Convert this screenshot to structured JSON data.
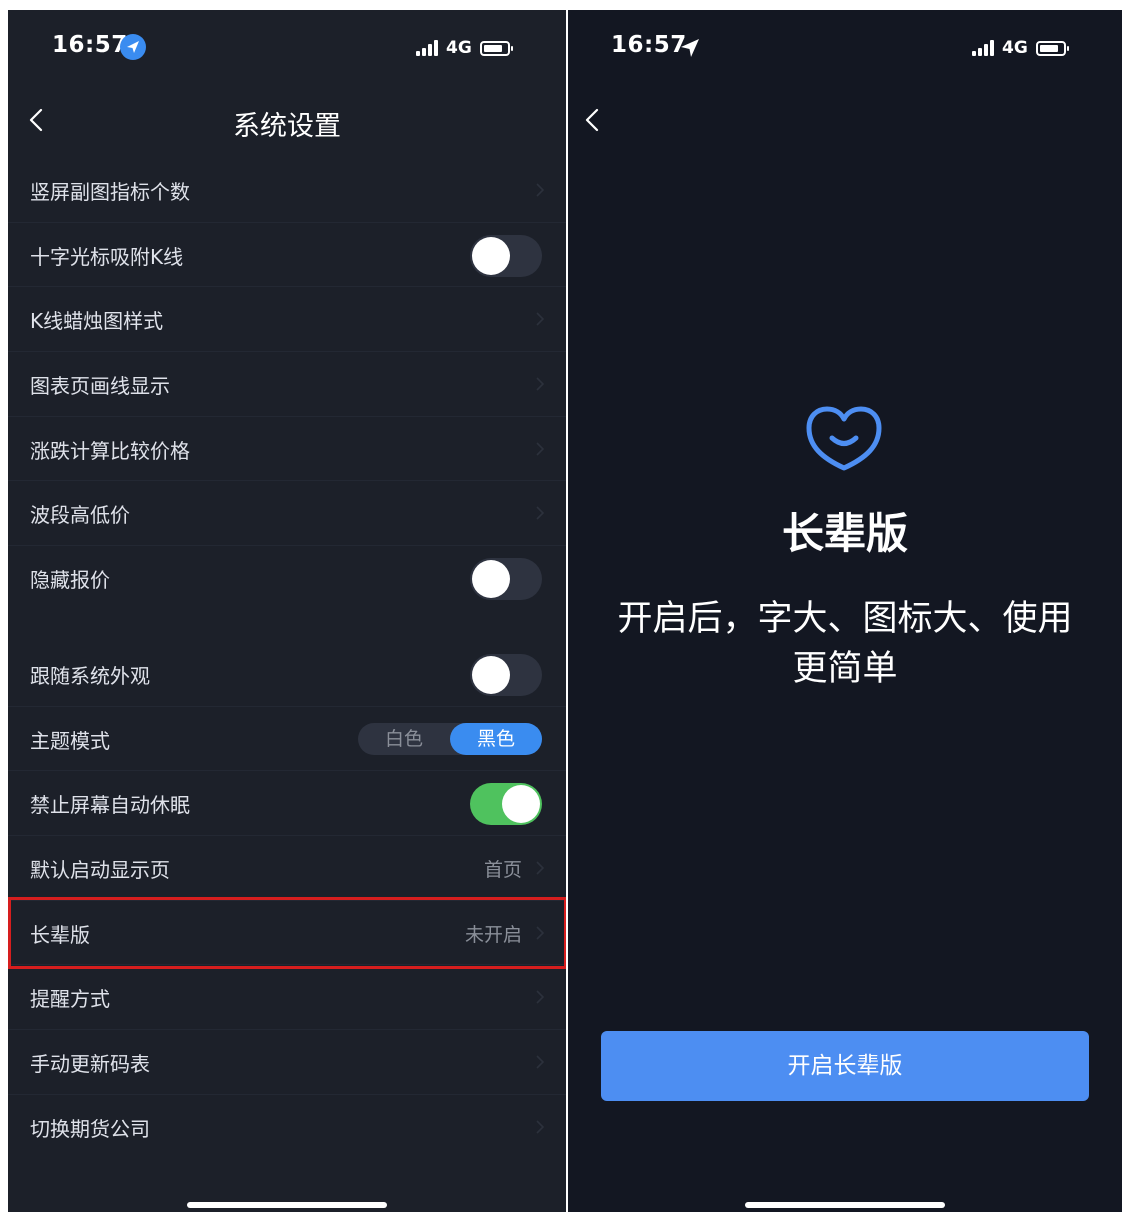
{
  "left_screen": {
    "status_bar": {
      "time": "16:57",
      "network": "4G"
    },
    "header": {
      "title": "系统设置"
    },
    "group_1": [
      {
        "label": "竖屏副图指标个数"
      },
      {
        "label": "十字光标吸附K线",
        "toggle": false
      },
      {
        "label": "K线蜡烛图样式"
      },
      {
        "label": "图表页画线显示"
      },
      {
        "label": "涨跌计算比较价格"
      },
      {
        "label": "波段高低价"
      },
      {
        "label": "隐藏报价",
        "toggle": false
      }
    ],
    "group_2": [
      {
        "label": "跟随系统外观",
        "toggle": false
      },
      {
        "label": "主题模式",
        "options": [
          "白色",
          "黑色"
        ],
        "selected": "黑色"
      },
      {
        "label": "禁止屏幕自动休眠",
        "toggle": true
      },
      {
        "label": "默认启动显示页",
        "value": "首页"
      },
      {
        "label": "长辈版",
        "value": "未开启"
      },
      {
        "label": "提醒方式"
      },
      {
        "label": "手动更新码表"
      },
      {
        "label": "切换期货公司"
      }
    ],
    "colors": {
      "background": "#1c2029",
      "accent": "#3a8cf0",
      "toggle_on": "#4fc25e",
      "highlight": "#d61e1e"
    }
  },
  "right_screen": {
    "status_bar": {
      "time": "16:57",
      "network": "4G"
    },
    "icon": "heart-smile-icon",
    "title": "长辈版",
    "description": "开启后，字大、图标大、使用更简单",
    "button_label": "开启长辈版",
    "colors": {
      "background": "#131722",
      "button": "#4d8ef2"
    }
  }
}
